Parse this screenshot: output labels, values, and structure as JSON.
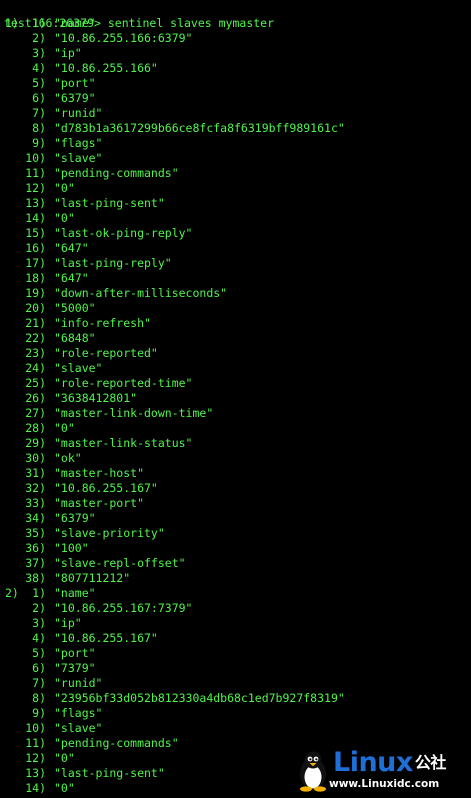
{
  "terminal": {
    "prompt": "test166:26379> sentinel slaves mymaster",
    "groups": [
      {
        "label": "1)",
        "entries": [
          {
            "i": "1)",
            "v": "\"name\""
          },
          {
            "i": "2)",
            "v": "\"10.86.255.166:6379\""
          },
          {
            "i": "3)",
            "v": "\"ip\""
          },
          {
            "i": "4)",
            "v": "\"10.86.255.166\""
          },
          {
            "i": "5)",
            "v": "\"port\""
          },
          {
            "i": "6)",
            "v": "\"6379\""
          },
          {
            "i": "7)",
            "v": "\"runid\""
          },
          {
            "i": "8)",
            "v": "\"d783b1a3617299b66ce8fcfa8f6319bff989161c\""
          },
          {
            "i": "9)",
            "v": "\"flags\""
          },
          {
            "i": "10)",
            "v": "\"slave\""
          },
          {
            "i": "11)",
            "v": "\"pending-commands\""
          },
          {
            "i": "12)",
            "v": "\"0\""
          },
          {
            "i": "13)",
            "v": "\"last-ping-sent\""
          },
          {
            "i": "14)",
            "v": "\"0\""
          },
          {
            "i": "15)",
            "v": "\"last-ok-ping-reply\""
          },
          {
            "i": "16)",
            "v": "\"647\""
          },
          {
            "i": "17)",
            "v": "\"last-ping-reply\""
          },
          {
            "i": "18)",
            "v": "\"647\""
          },
          {
            "i": "19)",
            "v": "\"down-after-milliseconds\""
          },
          {
            "i": "20)",
            "v": "\"5000\""
          },
          {
            "i": "21)",
            "v": "\"info-refresh\""
          },
          {
            "i": "22)",
            "v": "\"6848\""
          },
          {
            "i": "23)",
            "v": "\"role-reported\""
          },
          {
            "i": "24)",
            "v": "\"slave\""
          },
          {
            "i": "25)",
            "v": "\"role-reported-time\""
          },
          {
            "i": "26)",
            "v": "\"3638412801\""
          },
          {
            "i": "27)",
            "v": "\"master-link-down-time\""
          },
          {
            "i": "28)",
            "v": "\"0\""
          },
          {
            "i": "29)",
            "v": "\"master-link-status\""
          },
          {
            "i": "30)",
            "v": "\"ok\""
          },
          {
            "i": "31)",
            "v": "\"master-host\""
          },
          {
            "i": "32)",
            "v": "\"10.86.255.167\""
          },
          {
            "i": "33)",
            "v": "\"master-port\""
          },
          {
            "i": "34)",
            "v": "\"6379\""
          },
          {
            "i": "35)",
            "v": "\"slave-priority\""
          },
          {
            "i": "36)",
            "v": "\"100\""
          },
          {
            "i": "37)",
            "v": "\"slave-repl-offset\""
          },
          {
            "i": "38)",
            "v": "\"807711212\""
          }
        ]
      },
      {
        "label": "2)",
        "entries": [
          {
            "i": "1)",
            "v": "\"name\""
          },
          {
            "i": "2)",
            "v": "\"10.86.255.167:7379\""
          },
          {
            "i": "3)",
            "v": "\"ip\""
          },
          {
            "i": "4)",
            "v": "\"10.86.255.167\""
          },
          {
            "i": "5)",
            "v": "\"port\""
          },
          {
            "i": "6)",
            "v": "\"7379\""
          },
          {
            "i": "7)",
            "v": "\"runid\""
          },
          {
            "i": "8)",
            "v": "\"23956bf33d052b812330a4db68c1ed7b927f8319\""
          },
          {
            "i": "9)",
            "v": "\"flags\""
          },
          {
            "i": "10)",
            "v": "\"slave\""
          },
          {
            "i": "11)",
            "v": "\"pending-commands\""
          },
          {
            "i": "12)",
            "v": "\"0\""
          },
          {
            "i": "13)",
            "v": "\"last-ping-sent\""
          },
          {
            "i": "14)",
            "v": "\"0\""
          }
        ]
      }
    ]
  },
  "watermark": {
    "title": "Linux",
    "title_cn": "公社",
    "url": "www.Linuxidc.com",
    "icon": "penguin-icon"
  },
  "colors": {
    "background": "#000000",
    "text": "#50f44b",
    "brand_blue": "#1e6fd6"
  }
}
